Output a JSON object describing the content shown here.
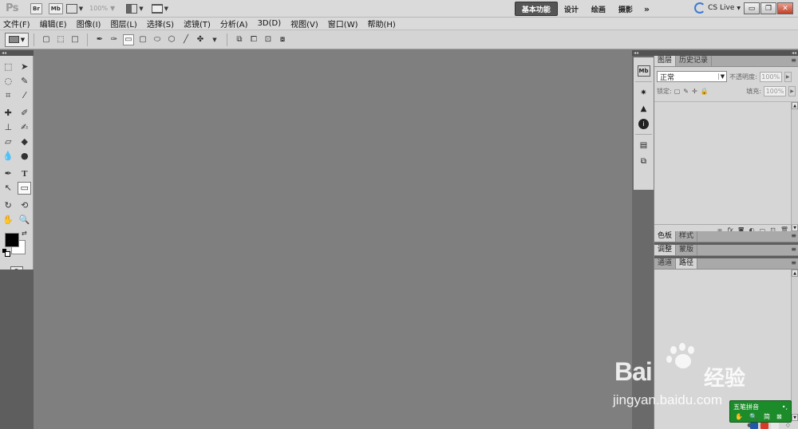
{
  "app": {
    "logo": "Ps",
    "bridge_label": "Br",
    "minibridge_label": "Mb",
    "zoom": "100%"
  },
  "workspaces": {
    "items": [
      "基本功能",
      "设计",
      "绘画",
      "摄影"
    ],
    "active": "基本功能",
    "more": "»"
  },
  "cs_live": "CS Live",
  "window_controls": {
    "minimize": "▭",
    "restore": "❐",
    "close": "✕"
  },
  "menu": [
    "文件(F)",
    "编辑(E)",
    "图像(I)",
    "图层(L)",
    "选择(S)",
    "滤镜(T)",
    "分析(A)",
    "3D(D)",
    "视图(V)",
    "窗口(W)",
    "帮助(H)"
  ],
  "collapse_arrows": "◂◂",
  "layers_panel": {
    "tabs": [
      "图层",
      "历史记录"
    ],
    "active_tab": "图层",
    "blend_mode": "正常",
    "opacity_label": "不透明度:",
    "opacity_value": "100%",
    "lock_label": "锁定:",
    "fill_label": "填充:",
    "fill_value": "100%"
  },
  "color_panel": {
    "tabs": [
      "色板",
      "样式"
    ]
  },
  "adjust_panel": {
    "tabs": [
      "调整",
      "蒙版"
    ]
  },
  "paths_panel": {
    "tabs": [
      "通道",
      "路径"
    ],
    "active_tab": "路径"
  },
  "ime": {
    "name": "五笔拼音",
    "mode": "简",
    "punct": "•,"
  },
  "watermark": {
    "brand": "Bai",
    "brand_cn": "经验",
    "url": "jingyan.baidu.com"
  }
}
